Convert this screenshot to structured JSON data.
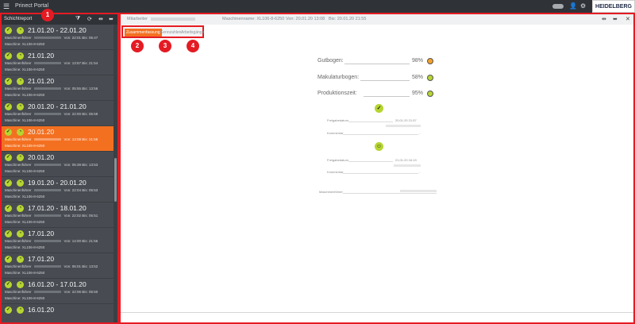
{
  "app": {
    "title": "Prinect Portal",
    "brand": "HEIDELBERG"
  },
  "icons": {
    "menu": "hamburger-icon",
    "user": "user-icon",
    "settings": "gear-icon"
  },
  "sidebar": {
    "title": "Schichtreport",
    "badge": "1",
    "items": [
      {
        "date": "21.01.20 - 22.01.20",
        "operator_label": "Maschinenführer",
        "times": "Von: 22:01 Bis: 05:47",
        "machine": "Maschine: XL106-8-6250",
        "active": false
      },
      {
        "date": "21.01.20",
        "operator_label": "Maschinenführer",
        "times": "Von: 13:57 Bis: 21:54",
        "machine": "Maschine: XL106-8-6250",
        "active": false
      },
      {
        "date": "21.01.20",
        "operator_label": "Maschinenführer",
        "times": "Von: 05:55 Bis: 13:56",
        "machine": "Maschine: XL106-8-6250",
        "active": false
      },
      {
        "date": "20.01.20 - 21.01.20",
        "operator_label": "Maschinenführer",
        "times": "Von: 22:00 Bis: 05:59",
        "machine": "Maschine: XL106-8-6250",
        "active": false
      },
      {
        "date": "20.01.20",
        "operator_label": "Maschinenführer",
        "times": "Von: 13:08 Bis: 21:55",
        "machine": "Maschine: XL106-8-6250",
        "active": true
      },
      {
        "date": "20.01.20",
        "operator_label": "Maschinenführer",
        "times": "Von: 05:39 Bis: 13:53",
        "machine": "Maschine: XL106-8-6250",
        "active": false
      },
      {
        "date": "19.01.20 - 20.01.20",
        "operator_label": "Maschinenführer",
        "times": "Von: 22:04 Bis: 05:53",
        "machine": "Maschine: XL106-8-6250",
        "active": false
      },
      {
        "date": "17.01.20 - 18.01.20",
        "operator_label": "Maschinenführer",
        "times": "Von: 22:02 Bis: 05:51",
        "machine": "Maschine: XL106-8-6250",
        "active": false
      },
      {
        "date": "17.01.20",
        "operator_label": "Maschinenführer",
        "times": "Von: 14:00 Bis: 21:56",
        "machine": "Maschine: XL106-8-6250",
        "active": false
      },
      {
        "date": "17.01.20",
        "operator_label": "Maschinenführer",
        "times": "Von: 06:01 Bis: 13:52",
        "machine": "Maschine: XL106-8-6250",
        "active": false
      },
      {
        "date": "16.01.20 - 17.01.20",
        "operator_label": "Maschinenführer",
        "times": "Von: 22:06 Bis: 05:50",
        "machine": "Maschine: XL106-8-6250",
        "active": false
      },
      {
        "date": "16.01.20",
        "operator_label": "",
        "times": "",
        "machine": "",
        "active": false
      }
    ]
  },
  "infobar": {
    "employee_label": "Mitarbeiter",
    "machine_text": "Maschinenname: XL106-8-6250",
    "from_text": "Von: 20.01.20 13:08",
    "to_text": "Bis: 20.01.20 21:55"
  },
  "tabs": [
    {
      "label": "Zusammenfassung",
      "badge": "2",
      "active": true
    },
    {
      "label": "Kennzahlen",
      "badge": "3",
      "active": false
    },
    {
      "label": "Arbeitsgänge",
      "badge": "4",
      "active": false
    }
  ],
  "summary": {
    "stats": [
      {
        "label": "Gutbogen:",
        "value": "98%",
        "color": "#f4a127"
      },
      {
        "label": "Makulaturbogen:",
        "value": "58%",
        "color": "#b6d531"
      },
      {
        "label": "Produktionszeit:",
        "value": "95%",
        "color": "#b6d531"
      }
    ],
    "signoff1": {
      "release_label": "Freigabedatum",
      "release_value": "20.01.20 21:57",
      "comment_label": "Kommentar",
      "comment_value": "-"
    },
    "signoff2": {
      "release_label": "Freigabedatum",
      "release_value": "21.01.20 16:19",
      "comment_label": "Kommentar",
      "comment_value": "-"
    },
    "operator_label": "Maschinenführer"
  }
}
